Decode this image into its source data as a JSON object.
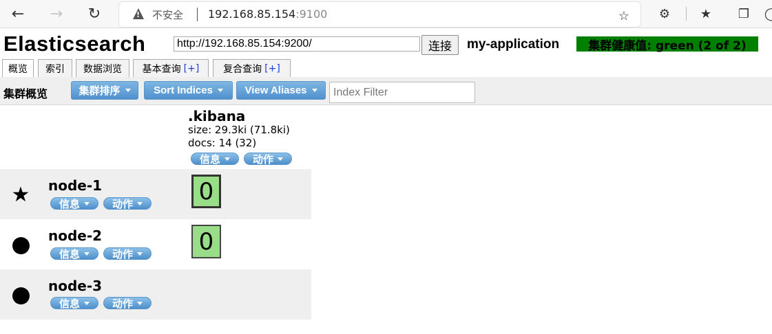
{
  "browser": {
    "security_label": "不安全",
    "url_host": "192.168.85.154",
    "url_port": ":9100"
  },
  "header": {
    "app_title": "Elasticsearch",
    "connect_url": "http://192.168.85.154:9200/",
    "connect_label": "连接",
    "cluster_name": "my-application",
    "health_text": "集群健康值: green (2 of 2)",
    "health_color": "#008000"
  },
  "tabs": [
    {
      "label": "概览",
      "plus": ""
    },
    {
      "label": "索引",
      "plus": ""
    },
    {
      "label": "数据浏览",
      "plus": ""
    },
    {
      "label": "基本查询",
      "plus": "[+]"
    },
    {
      "label": "复合查询",
      "plus": "[+]"
    }
  ],
  "toolbar": {
    "title": "集群概览",
    "sort_cluster": "集群排序",
    "sort_indices": "Sort Indices",
    "view_aliases": "View Aliases",
    "filter_placeholder": "Index Filter"
  },
  "index": {
    "name": ".kibana",
    "size": "size: 29.3ki (71.8ki)",
    "docs": "docs: 14 (32)",
    "info_label": "信息",
    "action_label": "动作"
  },
  "nodes": [
    {
      "name": "node-1",
      "symbol": "star",
      "info_label": "信息",
      "action_label": "动作",
      "shard": "0"
    },
    {
      "name": "node-2",
      "symbol": "dot",
      "info_label": "信息",
      "action_label": "动作",
      "shard": "0"
    },
    {
      "name": "node-3",
      "symbol": "dot",
      "info_label": "信息",
      "action_label": "动作",
      "shard": ""
    }
  ],
  "colors": {
    "shard_fill": "#99dd88",
    "button_blue": "#4f92cf"
  }
}
